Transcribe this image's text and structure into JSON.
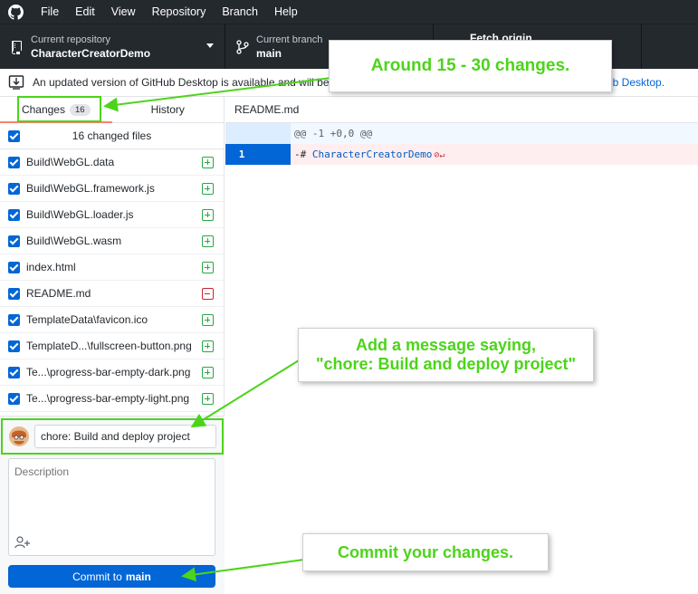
{
  "menu": {
    "items": [
      "File",
      "Edit",
      "View",
      "Repository",
      "Branch",
      "Help"
    ]
  },
  "toolbar": {
    "repo_label": "Current repository",
    "repo_value": "CharacterCreatorDemo",
    "branch_label": "Current branch",
    "branch_value": "main",
    "fetch_label": "Fetch origin"
  },
  "banner": {
    "text": "An updated version of GitHub Desktop is available and will be",
    "link": "ub Desktop."
  },
  "tabs": {
    "changes_label": "Changes",
    "changes_count": "16",
    "history_label": "History"
  },
  "changes": {
    "header": "16 changed files",
    "files": [
      {
        "name": "Build\\WebGL.data",
        "status": "added"
      },
      {
        "name": "Build\\WebGL.framework.js",
        "status": "added"
      },
      {
        "name": "Build\\WebGL.loader.js",
        "status": "added"
      },
      {
        "name": "Build\\WebGL.wasm",
        "status": "added"
      },
      {
        "name": "index.html",
        "status": "added"
      },
      {
        "name": "README.md",
        "status": "deleted"
      },
      {
        "name": "TemplateData\\favicon.ico",
        "status": "added"
      },
      {
        "name": "TemplateD...\\fullscreen-button.png",
        "status": "added"
      },
      {
        "name": "Te...\\progress-bar-empty-dark.png",
        "status": "added"
      },
      {
        "name": "Te...\\progress-bar-empty-light.png",
        "status": "added"
      }
    ]
  },
  "commit": {
    "summary_value": "chore: Build and deploy project",
    "description_placeholder": "Description",
    "button_prefix": "Commit to",
    "button_branch": "main"
  },
  "diff": {
    "file_name": "README.md",
    "hunk_header": "@@ -1 +0,0 @@",
    "line_number": "1",
    "line_prefix": "-# ",
    "line_text": "CharacterCreatorDemo"
  },
  "annotations": {
    "callout_1": "Around 15 - 30 changes.",
    "callout_2_line1": "Add a message saying,",
    "callout_2_line2": "\"chore: Build and deploy project\"",
    "callout_3": "Commit your changes."
  },
  "colors": {
    "accent": "#0366d6",
    "annotation_green": "#4cd41a",
    "added_green": "#28a745",
    "deleted_red": "#cb2431",
    "toolbar_dark": "#24292e"
  }
}
